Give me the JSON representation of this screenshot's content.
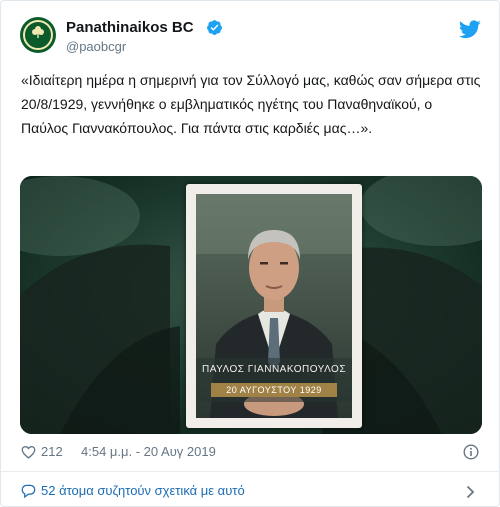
{
  "account": {
    "display_name": "Panathinaikos BC",
    "handle": "@paobcgr",
    "verified": true,
    "avatar_icon": "panathinaikos-clover-logo"
  },
  "tweet": {
    "text": "«Ιδιαίτερη ημέρα η σημερινή για τον Σύλλογό μας, καθώς σαν σήμερα στις 20/8/1929, γεννήθηκε ο εμβληματικός ηγέτης του Παναθηναϊκού, ο Παύλος Γιαννακόπουλος. Για πάντα στις καρδιές μας…».",
    "image": {
      "caption_name": "ΠΑΥΛΟΣ ΓΙΑΝΝΑΚΟΠΟΥΛΟΣ",
      "caption_date": "20 ΑΥΓΟΥΣΤΟΥ 1929"
    },
    "likes": "212",
    "timestamp": "4:54 μ.μ. - 20 Αυγ 2019"
  },
  "footer": {
    "conversation_text": "52 άτομα συζητούν σχετικά με αυτό"
  },
  "colors": {
    "text": "#14171a",
    "secondary": "#657786",
    "link": "#1b6cb5",
    "twitter_blue": "#1da1f2",
    "club_green": "#0a5a2c",
    "gold": "#a18246"
  },
  "icons": {
    "verified": "verified-badge-icon",
    "bird": "twitter-bird-icon",
    "like": "heart-icon",
    "info": "info-icon",
    "reply": "speech-bubble-icon",
    "more": "chevron-right-icon"
  }
}
